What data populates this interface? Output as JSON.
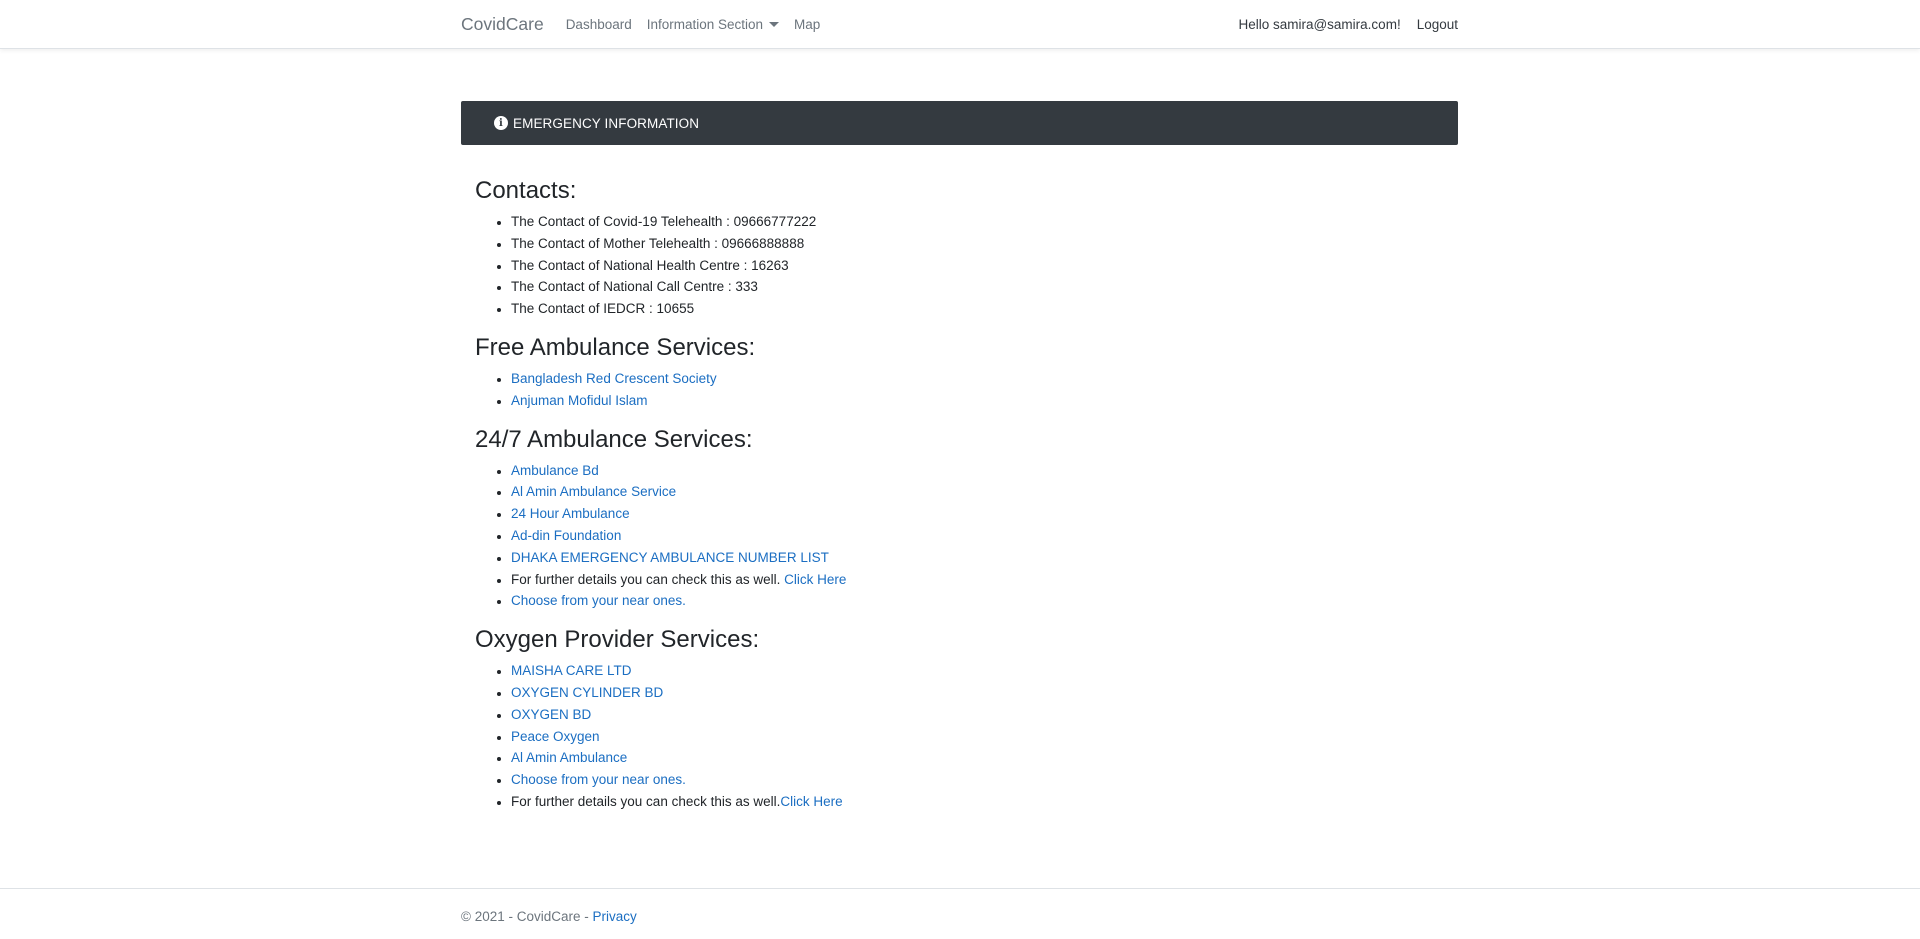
{
  "navbar": {
    "brand": "CovidCare",
    "links": [
      "Dashboard",
      "Information Section",
      "Map"
    ],
    "greeting": "Hello samira@samira.com!",
    "logout": "Logout"
  },
  "emergency": {
    "title": "EMERGENCY INFORMATION",
    "icon": "info-icon"
  },
  "contacts": {
    "heading": "Contacts:",
    "items": [
      "The Contact of Covid-19 Telehealth : 09666777222",
      "The Contact of Mother Telehealth : 09666888888",
      "The Contact of National Health Centre : 16263",
      "The Contact of National Call Centre : 333",
      "The Contact of IEDCR : 10655"
    ]
  },
  "free_ambulance": {
    "heading": "Free Ambulance Services:",
    "links": [
      "Bangladesh Red Crescent Society",
      "Anjuman Mofidul Islam"
    ]
  },
  "ambulance_247": {
    "heading": "24/7 Ambulance Services:",
    "links": [
      "Ambulance Bd",
      "Al Amin Ambulance Service",
      "24 Hour Ambulance",
      "Ad-din Foundation",
      "DHAKA EMERGENCY AMBULANCE NUMBER LIST"
    ],
    "further_text": "For further details you can check this as well. ",
    "further_link": "Click Here",
    "near_link": "Choose from your near ones."
  },
  "oxygen": {
    "heading": "Oxygen Provider Services:",
    "links": [
      "MAISHA CARE LTD",
      "OXYGEN CYLINDER BD",
      "OXYGEN BD",
      "Peace Oxygen",
      "Al Amin Ambulance",
      "Choose from your near ones."
    ],
    "further_text": "For further details you can check this as well.",
    "further_link": "Click Here"
  },
  "footer": {
    "text": "© 2021 - CovidCare - ",
    "privacy": "Privacy"
  },
  "colors": {
    "link": "#1b6ec2",
    "header_bar": "#343a40",
    "nav_text": "#6c757d"
  }
}
